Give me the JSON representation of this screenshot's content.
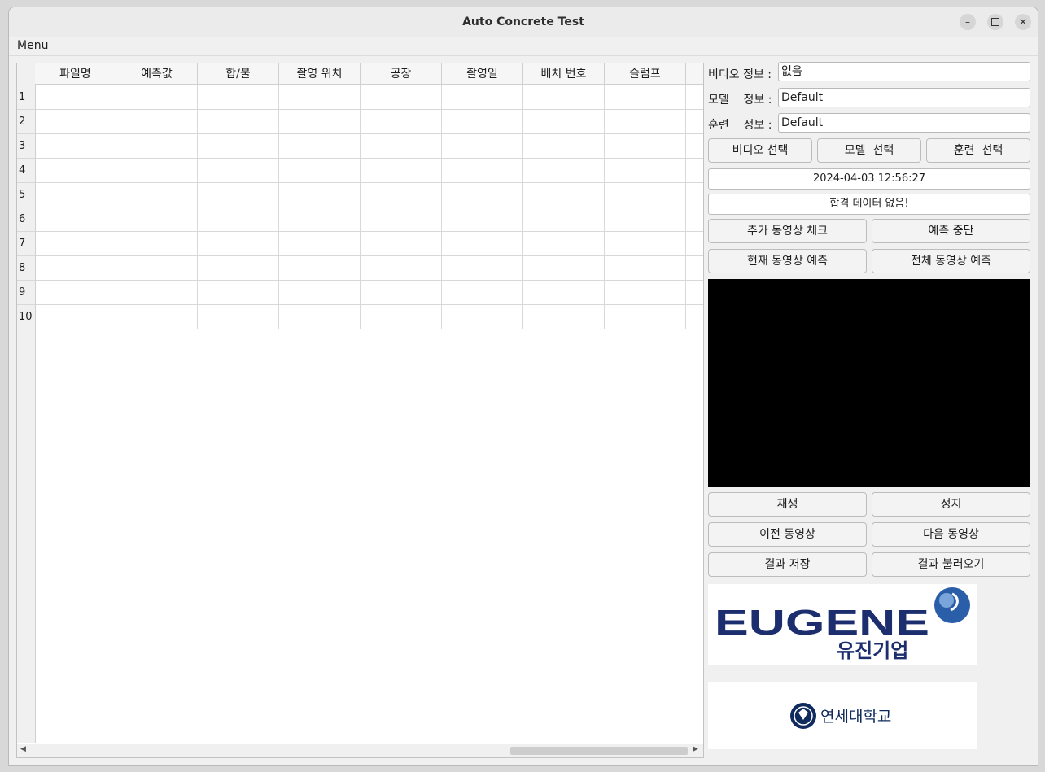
{
  "window": {
    "title": "Auto Concrete Test"
  },
  "menubar": {
    "menu_label": "Menu"
  },
  "table": {
    "columns": [
      "파일명",
      "예측값",
      "합/불",
      "촬영 위치",
      "공장",
      "촬영일",
      "배치 번호",
      "슬럼프"
    ],
    "rows": [
      "1",
      "2",
      "3",
      "4",
      "5",
      "6",
      "7",
      "8",
      "9",
      "10"
    ]
  },
  "info": {
    "video_label": "비디오 정보 :",
    "video_value": "없음",
    "model_label": "모델    정보 :",
    "model_value": "Default",
    "train_label": "훈련    정보 :",
    "train_value": "Default"
  },
  "buttons": {
    "select_video": "비디오 선택",
    "select_model": "모델  선택",
    "select_train": "훈련  선택",
    "check_more_videos": "추가 동영상 체크",
    "stop_prediction": "예측 중단",
    "predict_current": "현재 동영상 예측",
    "predict_all": "전체 동영상 예측",
    "play": "재생",
    "stop": "정지",
    "prev_video": "이전 동영상",
    "next_video": "다음 동영상",
    "save_result": "결과 저장",
    "load_result": "결과 불러오기"
  },
  "status": {
    "datetime": "2024-04-03 12:56:27",
    "pass_data": "합격 데이터 없음!"
  },
  "logos": {
    "eugene_en": "EUGENE",
    "eugene_ko": "유진기업",
    "yonsei_ko": "연세대학교"
  },
  "colors": {
    "eugene_navy": "#1d2e6e",
    "eugene_globe": "#2a5ea8",
    "yonsei_navy": "#0f2a5c"
  }
}
